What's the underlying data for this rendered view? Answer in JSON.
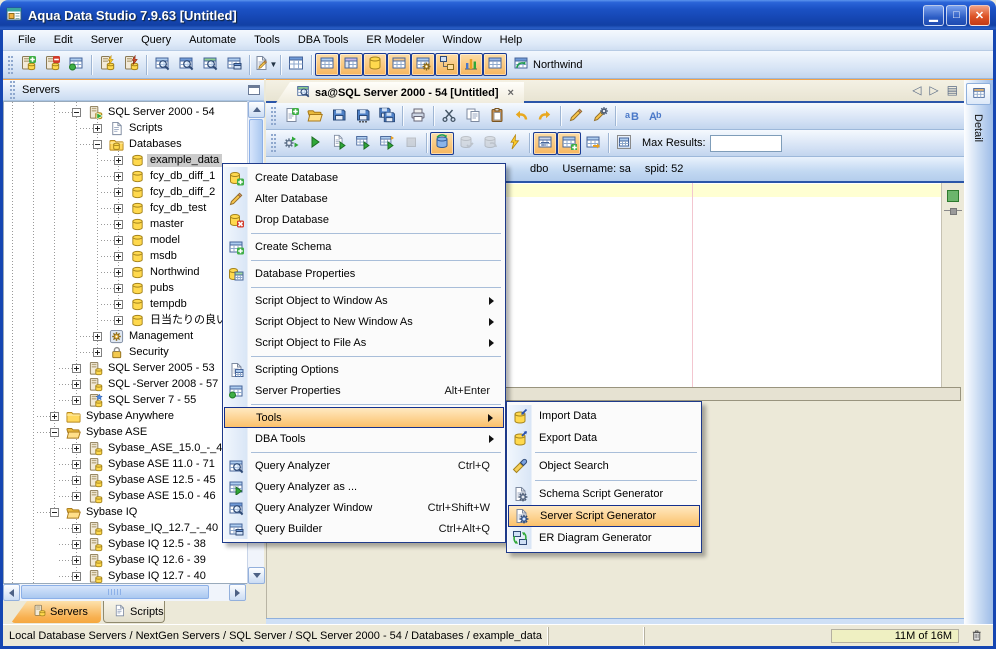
{
  "window": {
    "title": "Aqua Data Studio 7.9.63 [Untitled]"
  },
  "menubar": {
    "items": [
      "File",
      "Edit",
      "Server",
      "Query",
      "Automate",
      "Tools",
      "DBA Tools",
      "ER Modeler",
      "Window",
      "Help"
    ]
  },
  "main_toolbar": {
    "buttons": [
      {
        "name": "register-server"
      },
      {
        "name": "unregister-server"
      },
      {
        "name": "server-grid"
      },
      {
        "sep": true
      },
      {
        "name": "connect-server"
      },
      {
        "name": "disconnect-server"
      },
      {
        "sep": true
      },
      {
        "name": "query-analyzer"
      },
      {
        "name": "query-analyzer-window"
      },
      {
        "name": "query-window"
      },
      {
        "name": "query-builder"
      },
      {
        "sep": true
      },
      {
        "name": "open-script",
        "dropdown": true
      },
      {
        "sep": true
      },
      {
        "name": "schema-browser"
      },
      {
        "sep": true
      },
      {
        "name": "view-table",
        "toggled": true
      },
      {
        "name": "view-detail",
        "toggled": true
      },
      {
        "name": "view-database",
        "toggled": true
      },
      {
        "name": "view-grid",
        "toggled": true
      },
      {
        "name": "view-procedures",
        "toggled": true
      },
      {
        "name": "view-relations",
        "toggled": true
      },
      {
        "name": "view-chart",
        "toggled": true
      },
      {
        "name": "view-matrix",
        "toggled": true
      }
    ],
    "combo": {
      "icon": "refresh-window",
      "label": "Northwind"
    }
  },
  "servers_panel": {
    "title": "Servers",
    "tabs": [
      {
        "label": "Servers",
        "icon": "server",
        "active": true
      },
      {
        "label": "Scripts",
        "icon": "scripts",
        "active": false
      }
    ],
    "tree": {
      "items": [
        {
          "label": "SQL Server 2000 - 54",
          "depth": 3,
          "expand": "minus",
          "icon": "server-connected"
        },
        {
          "label": "Scripts",
          "depth": 4,
          "expand": "plus",
          "icon": "scripts"
        },
        {
          "label": "Databases",
          "depth": 4,
          "expand": "minus",
          "icon": "db-folder"
        },
        {
          "label": "example_data",
          "depth": 5,
          "expand": "plus",
          "icon": "database",
          "selected": true
        },
        {
          "label": "fcy_db_diff_1",
          "depth": 5,
          "expand": "plus",
          "icon": "database"
        },
        {
          "label": "fcy_db_diff_2",
          "depth": 5,
          "expand": "plus",
          "icon": "database"
        },
        {
          "label": "fcy_db_test",
          "depth": 5,
          "expand": "plus",
          "icon": "database"
        },
        {
          "label": "master",
          "depth": 5,
          "expand": "plus",
          "icon": "database"
        },
        {
          "label": "model",
          "depth": 5,
          "expand": "plus",
          "icon": "database"
        },
        {
          "label": "msdb",
          "depth": 5,
          "expand": "plus",
          "icon": "database"
        },
        {
          "label": "Northwind",
          "depth": 5,
          "expand": "plus",
          "icon": "database"
        },
        {
          "label": "pubs",
          "depth": 5,
          "expand": "plus",
          "icon": "database"
        },
        {
          "label": "tempdb",
          "depth": 5,
          "expand": "plus",
          "icon": "database"
        },
        {
          "label": "日当たりの良い",
          "depth": 5,
          "expand": "plus",
          "icon": "database"
        },
        {
          "label": "Management",
          "depth": 4,
          "expand": "plus",
          "icon": "management"
        },
        {
          "label": "Security",
          "depth": 4,
          "expand": "plus",
          "icon": "security"
        },
        {
          "label": "SQL Server 2005 - 53",
          "depth": 3,
          "expand": "plus",
          "icon": "server"
        },
        {
          "label": "SQL -Server 2008 - 57",
          "depth": 3,
          "expand": "plus",
          "icon": "server"
        },
        {
          "label": "SQL Server 7 - 55",
          "depth": 3,
          "expand": "plus",
          "icon": "server-star"
        },
        {
          "label": "Sybase Anywhere",
          "depth": 2,
          "expand": "plus",
          "icon": "folder"
        },
        {
          "label": "Sybase ASE",
          "depth": 2,
          "expand": "minus",
          "icon": "folder-open"
        },
        {
          "label": "Sybase_ASE_15.0_-_4",
          "depth": 3,
          "expand": "plus",
          "icon": "server"
        },
        {
          "label": "Sybase ASE 11.0 - 71",
          "depth": 3,
          "expand": "plus",
          "icon": "server"
        },
        {
          "label": "Sybase ASE 12.5 - 45",
          "depth": 3,
          "expand": "plus",
          "icon": "server"
        },
        {
          "label": "Sybase ASE 15.0 - 46",
          "depth": 3,
          "expand": "plus",
          "icon": "server"
        },
        {
          "label": "Sybase IQ",
          "depth": 2,
          "expand": "minus",
          "icon": "folder-open"
        },
        {
          "label": "Sybase_IQ_12.7_-_40",
          "depth": 3,
          "expand": "plus",
          "icon": "server"
        },
        {
          "label": "Sybase IQ 12.5 - 38",
          "depth": 3,
          "expand": "plus",
          "icon": "server"
        },
        {
          "label": "Sybase IQ 12.6 - 39",
          "depth": 3,
          "expand": "plus",
          "icon": "server"
        },
        {
          "label": "Sybase IQ 12.7 - 40",
          "depth": 3,
          "expand": "plus",
          "icon": "server"
        }
      ]
    }
  },
  "document": {
    "tab": {
      "title": "sa@SQL Server 2000 - 54 [Untitled]",
      "icon": "query-tab",
      "close": "x"
    },
    "toolbar1": [
      {
        "name": "new-file"
      },
      {
        "name": "open-file"
      },
      {
        "name": "save"
      },
      {
        "name": "save-as"
      },
      {
        "name": "save-all"
      },
      {
        "sep": true
      },
      {
        "name": "print"
      },
      {
        "sep": true
      },
      {
        "name": "cut"
      },
      {
        "name": "copy"
      },
      {
        "name": "paste"
      },
      {
        "name": "undo"
      },
      {
        "name": "redo"
      },
      {
        "sep": true
      },
      {
        "name": "format-sql"
      },
      {
        "name": "format-options"
      },
      {
        "sep": true
      },
      {
        "name": "lowercase"
      },
      {
        "name": "uppercase"
      }
    ],
    "toolbar2": [
      {
        "name": "execute"
      },
      {
        "name": "play"
      },
      {
        "name": "execute-script"
      },
      {
        "name": "execute-grid"
      },
      {
        "name": "execute-export"
      },
      {
        "name": "stop",
        "disabled": true
      },
      {
        "sep": true
      },
      {
        "name": "auto-commit",
        "toggled": true
      },
      {
        "name": "commit",
        "disabled": true
      },
      {
        "name": "rollback",
        "disabled": true
      },
      {
        "name": "reconnect"
      },
      {
        "sep": true
      },
      {
        "name": "results-text",
        "toggled": true
      },
      {
        "name": "results-grid",
        "toggled": true
      },
      {
        "name": "results-export"
      },
      {
        "sep": true
      },
      {
        "name": "pin-grid"
      }
    ],
    "max_results": {
      "label": "Max Results:",
      "value": ""
    },
    "info_strip": {
      "schema": "dbo",
      "username_label": "Username:  sa",
      "spid_label": "spid:  52"
    },
    "detail_tab": "Detail"
  },
  "context_menu": {
    "items": [
      {
        "label": "Create Database",
        "icon": "create-database"
      },
      {
        "label": "Alter Database",
        "icon": "alter-database"
      },
      {
        "label": "Drop Database",
        "icon": "drop-database",
        "sep": true
      },
      {
        "label": "Create Schema",
        "icon": "create-schema",
        "sep": true
      },
      {
        "label": "Database Properties",
        "icon": "database-properties",
        "sep": true
      },
      {
        "label": "Script Object to Window As",
        "submenu": true
      },
      {
        "label": "Script Object to New Window As",
        "submenu": true
      },
      {
        "label": "Script Object to File As",
        "submenu": true,
        "sep": true
      },
      {
        "label": "Scripting Options",
        "icon": "scripting-options"
      },
      {
        "label": "Server Properties",
        "icon": "server-properties",
        "shortcut": "Alt+Enter",
        "sep": true
      },
      {
        "label": "Tools",
        "submenu": true,
        "highlighted": true
      },
      {
        "label": "DBA Tools",
        "submenu": true,
        "sep": true
      },
      {
        "label": "Query Analyzer",
        "icon": "query-analyzer",
        "shortcut": "Ctrl+Q"
      },
      {
        "label": "Query Analyzer as ...",
        "icon": "query-analyzer-as"
      },
      {
        "label": "Query Analyzer Window",
        "icon": "query-analyzer-window",
        "shortcut": "Ctrl+Shift+W"
      },
      {
        "label": "Query Builder",
        "icon": "query-builder",
        "shortcut": "Ctrl+Alt+Q"
      }
    ]
  },
  "tools_submenu": {
    "items": [
      {
        "label": "Import Data",
        "icon": "import-data"
      },
      {
        "label": "Export Data",
        "icon": "export-data",
        "sep": true
      },
      {
        "label": "Object Search",
        "icon": "object-search",
        "sep": true
      },
      {
        "label": "Schema Script Generator",
        "icon": "schema-script-generator"
      },
      {
        "label": "Server Script Generator",
        "icon": "server-script-generator",
        "highlighted": true
      },
      {
        "label": "ER Diagram Generator",
        "icon": "er-diagram-generator"
      }
    ]
  },
  "statusbar": {
    "breadcrumb": "Local Database Servers / NextGen Servers / SQL Server / SQL Server 2000 - 54 / Databases / example_data",
    "memory": "11M of 16M"
  }
}
